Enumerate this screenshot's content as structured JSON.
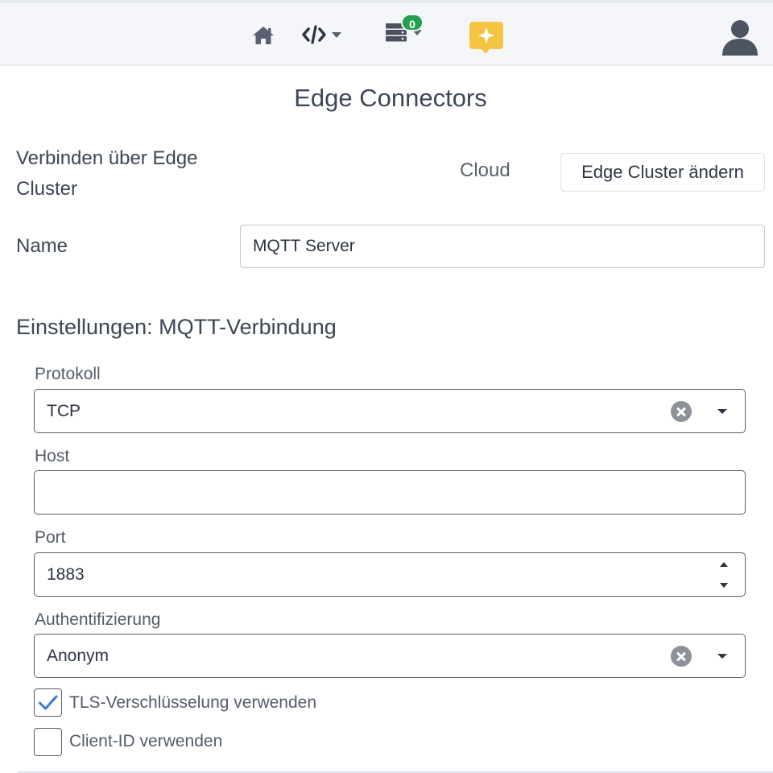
{
  "topbar": {
    "home_icon": "home-icon",
    "code_icon": "code-icon",
    "server_icon": "server-icon",
    "server_badge": "0",
    "ai_icon": "sparkle-message-icon",
    "user_icon": "user-avatar-icon",
    "colors": {
      "badge": "#22a04b",
      "ai_accent": "#f5c542"
    }
  },
  "page": {
    "title": "Edge Connectors",
    "cluster": {
      "label": "Verbinden über Edge Cluster",
      "value": "Cloud",
      "change_button": "Edge Cluster ändern"
    },
    "name": {
      "label": "Name",
      "value": "MQTT Server"
    }
  },
  "settings": {
    "title": "Einstellungen: MQTT-Verbindung",
    "protocol": {
      "label": "Protokoll",
      "value": "TCP"
    },
    "host": {
      "label": "Host",
      "value": ""
    },
    "port": {
      "label": "Port",
      "value": "1883"
    },
    "auth": {
      "label": "Authentifizierung",
      "value": "Anonym"
    },
    "tls": {
      "label": "TLS-Verschlüsselung verwenden",
      "checked": true
    },
    "client_id": {
      "label": "Client-ID verwenden",
      "checked": false
    }
  }
}
